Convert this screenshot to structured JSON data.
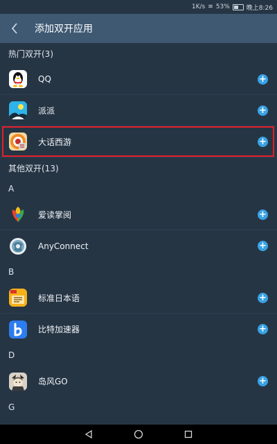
{
  "status_bar": {
    "speed": "1K/s",
    "battery": "53%",
    "time": "晚上8:26"
  },
  "app_bar": {
    "title": "添加双开应用"
  },
  "hot": {
    "header": "热门双开(3)",
    "items": [
      {
        "name": "QQ",
        "icon": "qq-penguin-icon"
      },
      {
        "name": "派派",
        "icon": "paipai-icon"
      },
      {
        "name": "大话西游",
        "icon": "dahuaxiyou-icon",
        "highlighted": true
      }
    ]
  },
  "other": {
    "header": "其他双开(13)",
    "groups": [
      {
        "letter": "A",
        "items": [
          {
            "name": "爱读掌阅",
            "icon": "aidu-icon"
          },
          {
            "name": "AnyConnect",
            "icon": "anyconnect-icon"
          }
        ]
      },
      {
        "letter": "B",
        "items": [
          {
            "name": "标准日本语",
            "icon": "japanese-book-icon"
          },
          {
            "name": "比特加速器",
            "icon": "bite-b-icon"
          }
        ]
      },
      {
        "letter": "D",
        "items": [
          {
            "name": "岛风GO",
            "icon": "daofeng-icon"
          }
        ]
      },
      {
        "letter": "G",
        "items": []
      }
    ]
  },
  "colors": {
    "background": "#263544",
    "app_bar": "#3f5973",
    "add_button": "#38a2e4",
    "highlight": "#e3202a"
  }
}
